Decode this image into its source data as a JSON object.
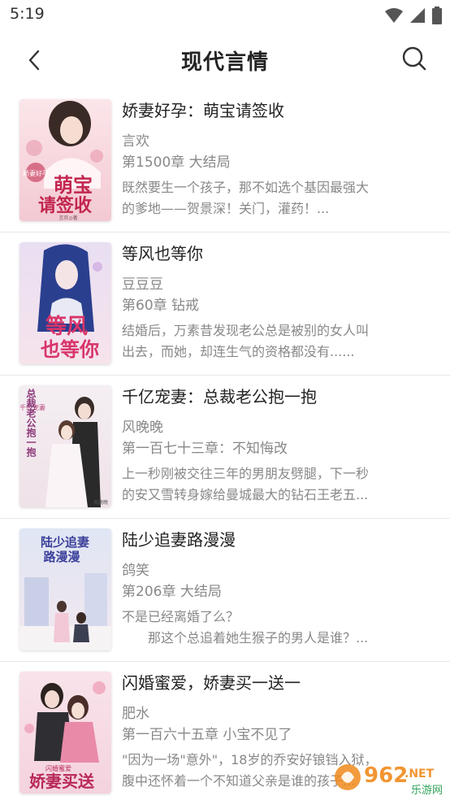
{
  "status_bar": {
    "time": "5:19"
  },
  "nav": {
    "title": "现代言情",
    "back_icon": "chevron-left-icon",
    "search_icon": "search-icon"
  },
  "books": [
    {
      "title": "娇妻好孕：萌宝请签收",
      "author": "言欢",
      "chapter": "第1500章 大结局",
      "desc_line1": "既然要生一个孩子，那不如选个基因最强大",
      "desc_line2": "的爹地——贺景深！关门，灌药！...",
      "cover_text_main": "萌宝",
      "cover_text_sub": "请签收",
      "cover_text_badge": "娇妻好孕",
      "cover_author": "言欢◎著"
    },
    {
      "title": "等风也等你",
      "author": "豆豆豆",
      "chapter": "第60章 钻戒",
      "desc_line1": "结婚后，万素昔发现老公总是被别的女人叫",
      "desc_line2": "出去，而她，却连生气的资格都没有......",
      "cover_text_main": "等风",
      "cover_text_sub": "也等你"
    },
    {
      "title": "千亿宠妻：总裁老公抱一抱",
      "author": "风晚晚",
      "chapter": "第一百七十三章：不知悔改",
      "desc_line1": "上一秒刚被交往三年的男朋友劈腿，下一秒",
      "desc_line2": "的安又雪转身嫁给曼城最大的钻石王老五...",
      "cover_text_main": "总裁老公抱一抱",
      "cover_text_sub": "千亿宠妻",
      "cover_author": "风晚晚"
    },
    {
      "title": "陆少追妻路漫漫",
      "author": "鸽笑",
      "chapter": "第206章 大结局",
      "desc_line1": "不是已经离婚了么？",
      "desc_line2": "　　那这个总追着她生猴子的男人是谁？...",
      "cover_text_main": "陆少追妻",
      "cover_text_sub": "路漫漫"
    },
    {
      "title": "闪婚蜜爱，娇妻买一送一",
      "author": "肥水",
      "chapter": "第一百六十五章 小宝不见了",
      "desc_line1": "\"因为一场\"意外\"，18岁的乔安好锒铛入狱，",
      "desc_line2": "腹中还怀着一个不知道父亲是谁的孩子...",
      "cover_text_main": "娇妻买送",
      "cover_text_sub": "闪婚蜜爱"
    }
  ],
  "watermark": {
    "text_main": "962",
    "text_net": ".NET",
    "text_sub": "乐游网"
  },
  "colors": {
    "accent": "#222222",
    "muted_text": "#888888",
    "divider": "#e8e8e8",
    "watermark_orange": "#f08a1c"
  }
}
